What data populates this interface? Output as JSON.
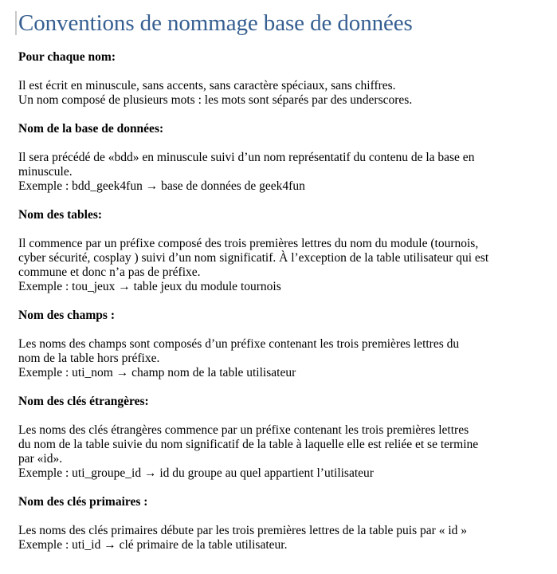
{
  "title": "Conventions de nommage base de données",
  "sections": [
    {
      "heading": "Pour chaque nom:",
      "lines": [
        "Il est écrit en minuscule, sans accents, sans caractère spéciaux, sans chiffres.",
        "Un nom composé de plusieurs mots : les mots sont séparés par des underscores."
      ]
    },
    {
      "heading": "Nom de la base de données:",
      "lines": [
        "Il sera précédé de «bdd» en minuscule suivi d’un nom représentatif du contenu de la base en",
        "minuscule.",
        "Exemple : bdd_geek4fun → base de données de geek4fun"
      ]
    },
    {
      "heading": "Nom des tables:",
      "lines": [
        "Il commence par un préfixe composé des trois premières lettres du nom du module (tournois,",
        "cyber sécurité, cosplay ) suivi d’un nom significatif. À l’exception de la table utilisateur qui est",
        "commune et donc n’a pas de préfixe.",
        "Exemple : tou_jeux → table jeux du module tournois"
      ]
    },
    {
      "heading": "Nom des champs :",
      "lines": [
        "Les noms des champs sont composés d’un préfixe contenant les trois premières lettres du",
        "nom de la table hors préfixe.",
        "Exemple : uti_nom → champ nom de la table utilisateur"
      ]
    },
    {
      "heading": "Nom des clés étrangères:",
      "lines": [
        "Les noms des clés étrangères commence par un préfixe contenant les trois premières lettres",
        "du nom de la table suivie du nom significatif de la table à laquelle elle est reliée et se termine",
        "par «id».",
        "Exemple : uti_groupe_id → id du groupe au quel appartient l’utilisateur"
      ]
    },
    {
      "heading": "Nom des clés primaires :",
      "lines": [
        "Les noms des clés primaires débute par les trois premières lettres de la table puis par « id »",
        "Exemple : uti_id → clé primaire de la table utilisateur."
      ]
    }
  ]
}
